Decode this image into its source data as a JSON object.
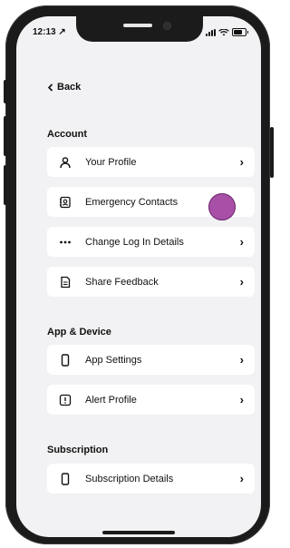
{
  "status_bar": {
    "time": "12:13 ↗"
  },
  "nav": {
    "back_label": "Back"
  },
  "sections": [
    {
      "title": "Account",
      "items": [
        {
          "label": "Your Profile",
          "icon": "person-icon",
          "chevron": "›"
        },
        {
          "label": "Emergency Contacts",
          "icon": "contacts-icon",
          "chevron": ""
        },
        {
          "label": "Change Log In Details",
          "icon": "dots-icon",
          "chevron": "›"
        },
        {
          "label": "Share Feedback",
          "icon": "document-icon",
          "chevron": "›"
        }
      ]
    },
    {
      "title": "App & Device",
      "items": [
        {
          "label": "App Settings",
          "icon": "phone-icon",
          "chevron": "›"
        },
        {
          "label": "Alert Profile",
          "icon": "alert-icon",
          "chevron": "›"
        }
      ]
    },
    {
      "title": "Subscription",
      "items": [
        {
          "label": "Subscription Details",
          "icon": "phone-icon",
          "chevron": "›"
        }
      ]
    }
  ],
  "colors": {
    "touch_indicator": "#a84fa8",
    "background": "#f2f2f4",
    "card": "#ffffff"
  }
}
